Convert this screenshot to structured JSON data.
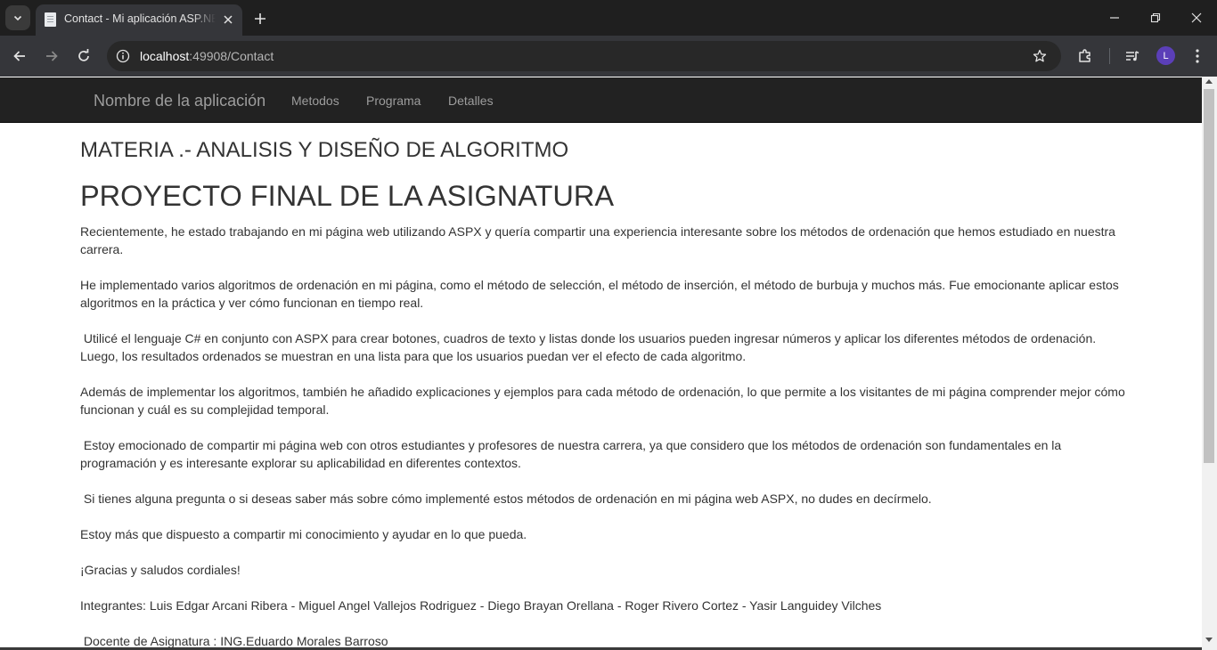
{
  "browser": {
    "tab_title": "Contact - Mi aplicación ASP.NET",
    "url_host": "localhost",
    "url_path": ":49908/Contact",
    "profile_initial": "L",
    "icons": {
      "tab_search": "chevron-down-icon",
      "favicon": "page-icon",
      "tab_close": "close-icon",
      "new_tab": "plus-icon",
      "back": "arrow-left-icon",
      "forward": "arrow-right-icon",
      "reload": "reload-icon",
      "site_info": "info-icon",
      "bookmark": "star-icon",
      "extensions": "puzzle-icon",
      "media": "media-control-icon",
      "menu": "kebab-menu-icon"
    }
  },
  "site_nav": {
    "brand": "Nombre de la aplicación",
    "links": [
      "Metodos",
      "Programa",
      "Detalles"
    ]
  },
  "page": {
    "subject": "MATERIA .- ANALISIS Y DISEÑO DE ALGORITMO",
    "title": "PROYECTO FINAL DE LA ASIGNATURA",
    "paragraphs": [
      "Recientemente, he estado trabajando en mi página web utilizando ASPX y quería compartir una experiencia interesante sobre los métodos de ordenación que hemos estudiado en nuestra carrera.",
      "He implementado varios algoritmos de ordenación en mi página, como el método de selección, el método de inserción, el método de burbuja y muchos más. Fue emocionante aplicar estos algoritmos en la práctica y ver cómo funcionan en tiempo real.",
      " Utilicé el lenguaje C# en conjunto con ASPX para crear botones, cuadros de texto y listas donde los usuarios pueden ingresar números y aplicar los diferentes métodos de ordenación. Luego, los resultados ordenados se muestran en una lista para que los usuarios puedan ver el efecto de cada algoritmo.",
      "Además de implementar los algoritmos, también he añadido explicaciones y ejemplos para cada método de ordenación, lo que permite a los visitantes de mi página comprender mejor cómo funcionan y cuál es su complejidad temporal.",
      " Estoy emocionado de compartir mi página web con otros estudiantes y profesores de nuestra carrera, ya que considero que los métodos de ordenación son fundamentales en la programación y es interesante explorar su aplicabilidad en diferentes contextos.",
      " Si tienes alguna pregunta o si deseas saber más sobre cómo implementé estos métodos de ordenación en mi página web ASPX, no dudes en decírmelo.",
      "Estoy más que dispuesto a compartir mi conocimiento y ayudar en lo que pueda.",
      "¡Gracias y saludos cordiales!",
      "Integrantes: Luis Edgar Arcani Ribera - Miguel Angel Vallejos Rodriguez - Diego Brayan Orellana - Roger Rivero Cortez - Yasir Languidey Vilches",
      " Docente de Asignatura : ING.Eduardo Morales Barroso"
    ]
  },
  "colors": {
    "chrome_bg": "#1f1f1f",
    "toolbar_bg": "#35363a",
    "navbar_bg": "#222222",
    "nav_text": "#9d9d9d",
    "body_text": "#333333",
    "avatar": "#5b3fb8"
  }
}
